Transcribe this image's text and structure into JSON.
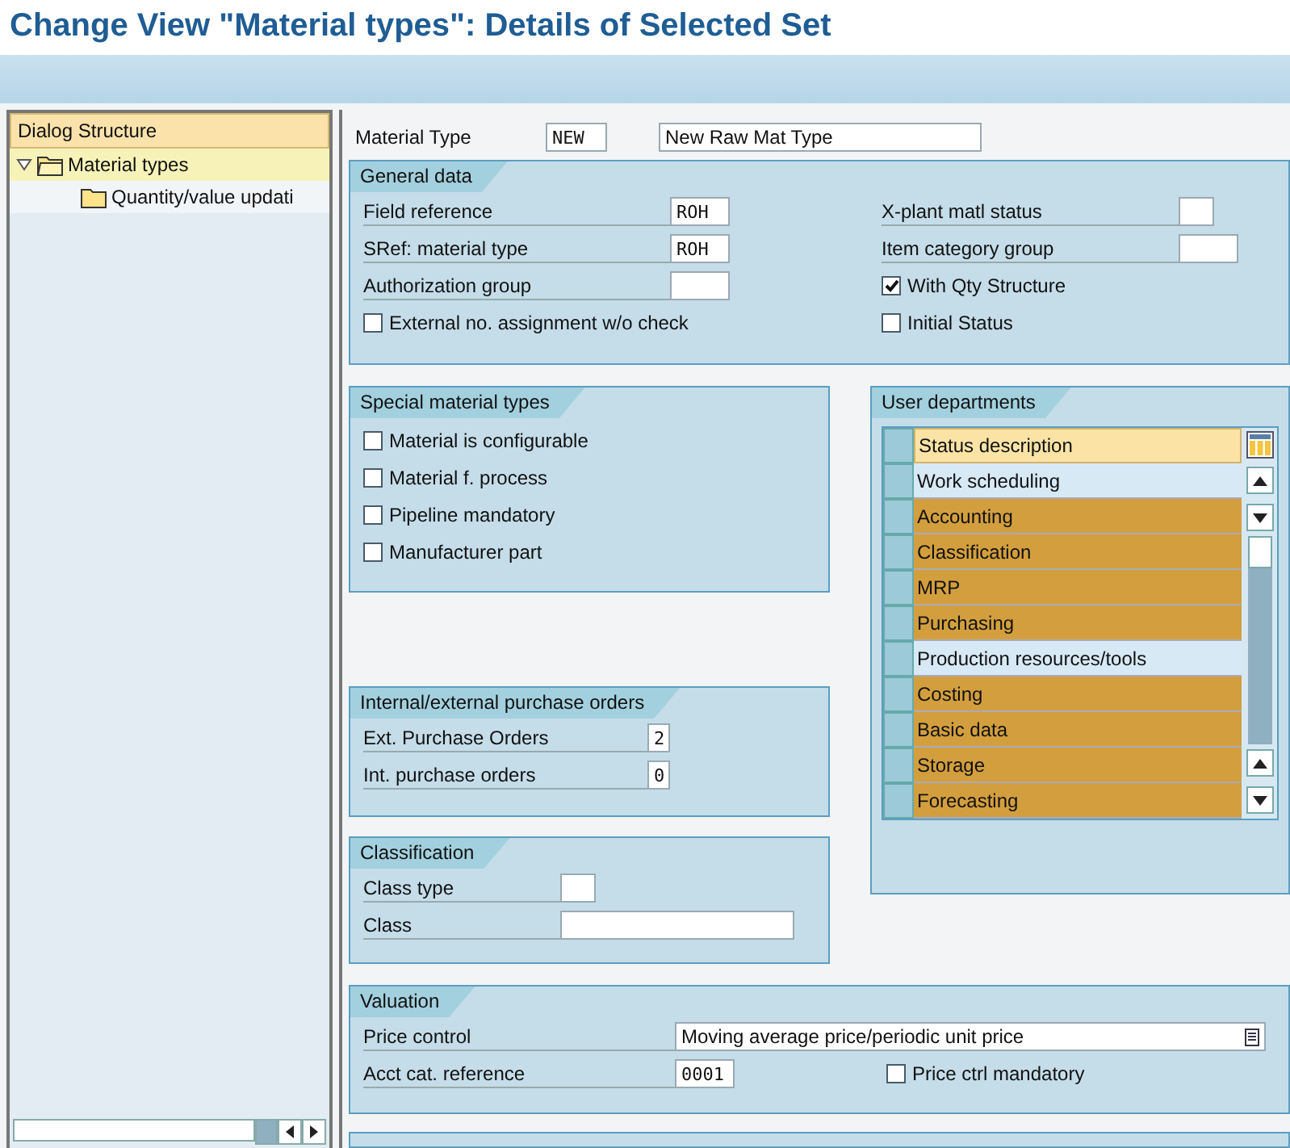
{
  "window": {
    "title": "Change View \"Material types\": Details of Selected Set"
  },
  "dialog_structure": {
    "title": "Dialog Structure",
    "items": [
      {
        "label": "Material types",
        "expanded": true,
        "selected": true,
        "children": [
          {
            "label": "Quantity/value updati",
            "selected": false
          }
        ]
      }
    ]
  },
  "material_type": {
    "label": "Material Type",
    "value": "NEW",
    "description": "New Raw Mat Type"
  },
  "general_data": {
    "title": "General data",
    "left_fields": [
      {
        "label": "Field reference",
        "value": "ROH"
      },
      {
        "label": "SRef: material type",
        "value": "ROH"
      },
      {
        "label": "Authorization group"
      }
    ],
    "left_checks": [
      {
        "label": "External no. assignment w/o check",
        "checked": false
      }
    ],
    "right_fields": [
      {
        "label": "X-plant matl status",
        "kind": "short"
      },
      {
        "label": "Item category group",
        "kind": "medium"
      }
    ],
    "right_checks": [
      {
        "label": "With Qty Structure",
        "checked": true
      },
      {
        "label": "Initial Status",
        "checked": false
      }
    ]
  },
  "special_material_types": {
    "title": "Special material types",
    "checks": [
      {
        "label": "Material is configurable",
        "checked": false
      },
      {
        "label": "Material f. process",
        "checked": false
      },
      {
        "label": "Pipeline mandatory",
        "checked": false
      },
      {
        "label": "Manufacturer part",
        "checked": false
      }
    ]
  },
  "purchase_orders": {
    "title": "Internal/external purchase orders",
    "fields": [
      {
        "label": "Ext. Purchase Orders",
        "value": "2"
      },
      {
        "label": "Int. purchase orders",
        "value": "0"
      }
    ]
  },
  "classification": {
    "title": "Classification",
    "fields": [
      {
        "label": "Class type",
        "kind": "short"
      },
      {
        "label": "Class",
        "kind": "long"
      }
    ]
  },
  "user_departments": {
    "title": "User departments",
    "column": "Status description",
    "rows": [
      {
        "label": "Work scheduling",
        "selected": false
      },
      {
        "label": "Accounting",
        "selected": true
      },
      {
        "label": "Classification",
        "selected": true
      },
      {
        "label": "MRP",
        "selected": true
      },
      {
        "label": "Purchasing",
        "selected": true
      },
      {
        "label": "Production resources/tools",
        "selected": false
      },
      {
        "label": "Costing",
        "selected": true
      },
      {
        "label": "Basic data",
        "selected": true
      },
      {
        "label": "Storage",
        "selected": true
      },
      {
        "label": "Forecasting",
        "selected": true
      }
    ]
  },
  "valuation": {
    "title": "Valuation",
    "price_control": {
      "label": "Price control",
      "value": "Moving average price/periodic unit price"
    },
    "acct_cat": {
      "label": "Acct cat. reference",
      "value": "0001"
    },
    "checks": [
      {
        "label": "Price ctrl mandatory",
        "checked": false
      }
    ]
  }
}
